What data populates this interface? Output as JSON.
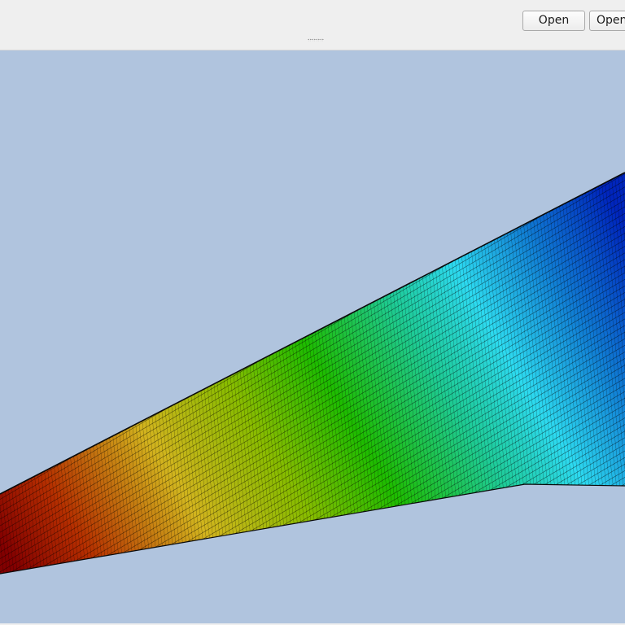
{
  "toolbar": {
    "buttons": [
      {
        "label": "Open"
      },
      {
        "label": "Open"
      }
    ]
  },
  "viewport": {
    "background_color": "#b0c4de",
    "model": "fem-mesh-beam",
    "colormap": "rainbow",
    "colormap_stops": [
      "#8b0000",
      "#e0c020",
      "#20c800",
      "#30e8ff",
      "#0028c8"
    ]
  }
}
